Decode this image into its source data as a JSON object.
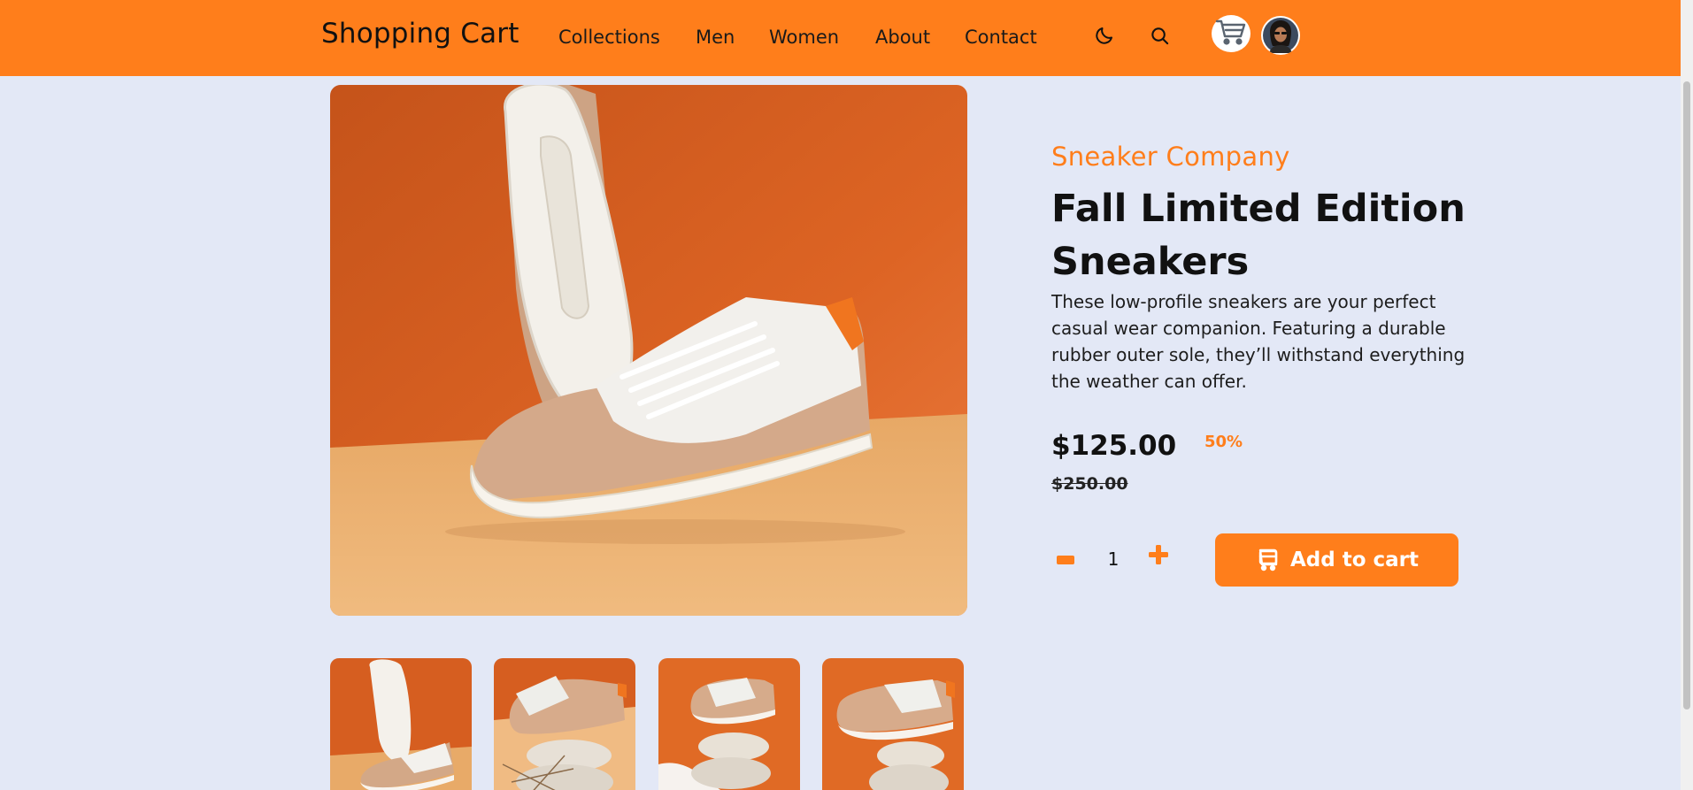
{
  "header": {
    "brand": "Shopping Cart",
    "nav": [
      "Collections",
      "Men",
      "Women",
      "About",
      "Contact"
    ],
    "icons": [
      "moon-icon",
      "search-icon",
      "cart-icon",
      "avatar"
    ]
  },
  "product": {
    "company": "Sneaker Company",
    "title": "Fall Limited Edition Sneakers",
    "description": "These low-profile sneakers are your perfect casual wear companion. Featuring a durable rubber outer sole, they’ll withstand everything the weather can offer.",
    "price": "$125.00",
    "discount": "50%",
    "old_price": "$250.00",
    "quantity": "1",
    "add_to_cart": "Add to cart"
  },
  "colors": {
    "accent": "#ff7e1b",
    "background": "#e3e8f6"
  }
}
